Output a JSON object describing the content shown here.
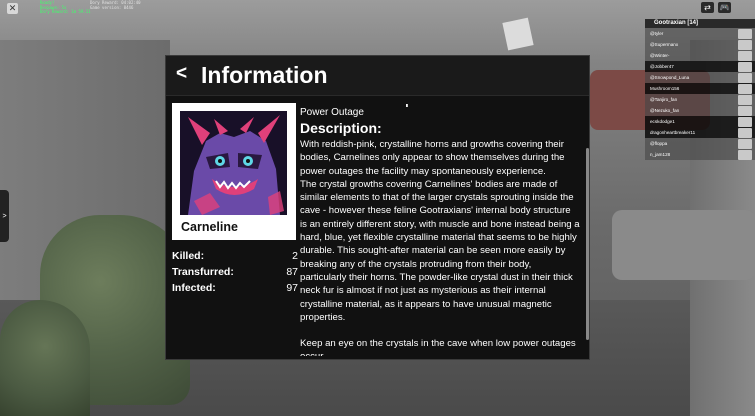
{
  "window": {
    "close_glyph": "✕"
  },
  "debug_left": [
    "Ready!",
    "Respawn: 5s",
    "Dory Reward: 1m 59.11"
  ],
  "debug_right": [
    "Dory Reward: 04:02:40",
    "Game version: 0446"
  ],
  "top_icons": [
    "⇄",
    "🎮"
  ],
  "side_tab": ">",
  "leaderboard": {
    "title": "Gootraxian [14]",
    "players": [
      "@tyler",
      "@Supermanx",
      "@Winter-",
      "@Jobber47",
      "@Snowpond_Luna",
      "Mushroom156",
      "@Tanjiro_fan",
      "@Nezuko_fan",
      "ecskdodge1",
      "dragonheartbreaker11",
      "@floppa",
      "n_jam128"
    ]
  },
  "dialog": {
    "back": "<",
    "title": "Information",
    "clipped_text": "' I",
    "character": {
      "name": "Carneline"
    },
    "stats": [
      {
        "label": "Killed:",
        "value": "2"
      },
      {
        "label": "Transfurred:",
        "value": "87"
      },
      {
        "label": "Infected:",
        "value": "97"
      }
    ],
    "category": "Power Outage",
    "description_heading": "Description:",
    "paragraphs": [
      "With reddish-pink, crystalline horns and growths covering their bodies, Carnelines only appear to show themselves during the power outages the facility may spontaneously experience.",
      "The crystal growths covering Carnelines' bodies are made of similar elements to that of the larger crystals sprouting inside the cave - however these feline Gootraxians' internal body structure is an entirely different story, with muscle and bone instead being a hard, blue, yet flexible crystalline material that seems to be highly durable. This sought-after material can be seen more easily by breaking any of the crystals protruding from their body, particularly their horns. The powder-like crystal dust in their thick neck fur is almost if not just as mysterious as their internal crystalline material, as it appears to have unusual magnetic properties.",
      "Keep an eye on the crystals in the cave when low power outages occur."
    ]
  },
  "colors": {
    "dialog_bg": "#111111",
    "portrait_bg": "#ffffff",
    "character_purple": "#6a4aa8",
    "horn_pink": "#e0407a"
  }
}
